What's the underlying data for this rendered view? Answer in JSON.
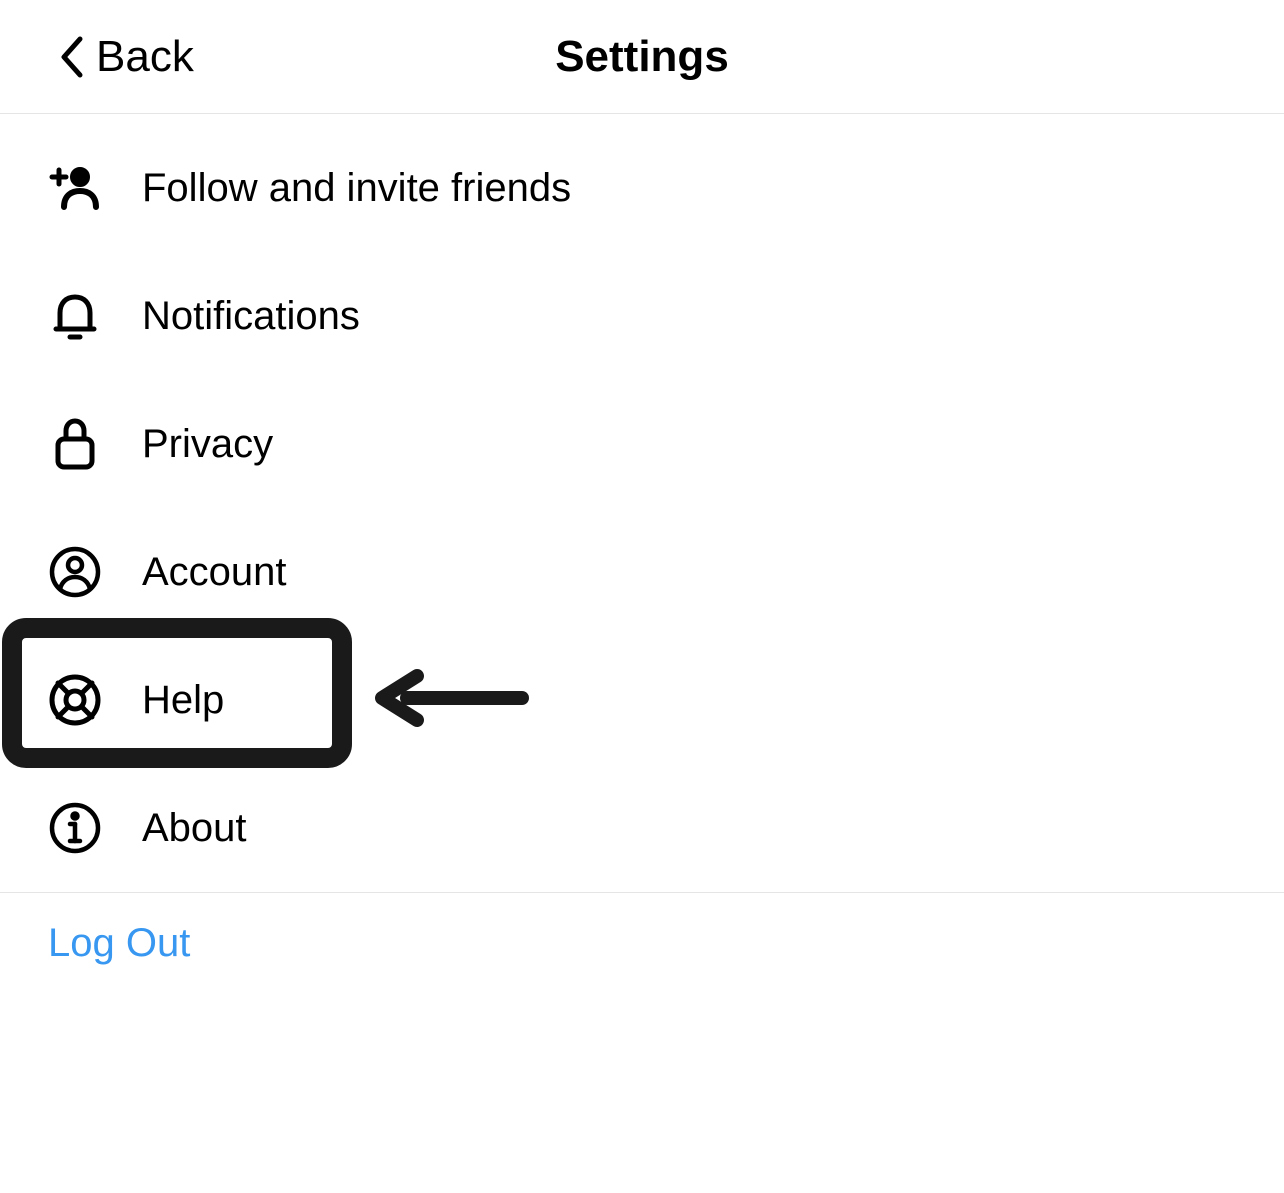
{
  "header": {
    "back_label": "Back",
    "title": "Settings"
  },
  "menu": {
    "items": [
      {
        "label": "Follow and invite friends"
      },
      {
        "label": "Notifications"
      },
      {
        "label": "Privacy"
      },
      {
        "label": "Account"
      },
      {
        "label": "Help"
      },
      {
        "label": "About"
      }
    ]
  },
  "logout": {
    "label": "Log Out"
  },
  "annotations": {
    "highlighted_item_index": 4
  }
}
